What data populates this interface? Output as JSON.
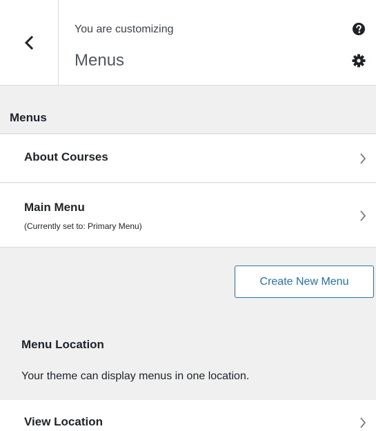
{
  "header": {
    "back_icon": "chevron-left-icon",
    "customizing_label": "You are customizing",
    "title": "Menus",
    "help_icon": "question-circle-icon",
    "settings_icon": "gear-icon"
  },
  "section": {
    "heading": "Menus"
  },
  "menus": {
    "items": [
      {
        "label": "About Courses",
        "sub": ""
      },
      {
        "label": "Main Menu",
        "sub": "(Currently set to: Primary Menu)"
      }
    ]
  },
  "actions": {
    "create_label": "Create New Menu"
  },
  "location": {
    "heading": "Menu Location",
    "description": "Your theme can display menus in one location.",
    "view_label": "View Location"
  },
  "colors": {
    "accent": "#2271b1",
    "panel_bg": "#f0f0f1",
    "row_bg": "#ffffff",
    "border": "#dcdcde"
  }
}
